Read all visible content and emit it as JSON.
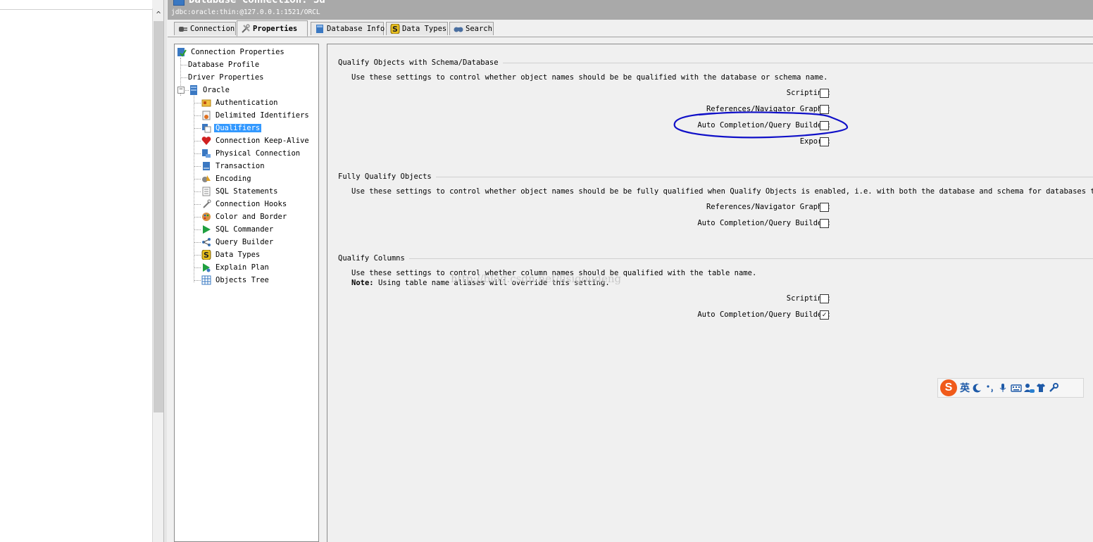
{
  "window": {
    "title": "Database Connection: 3d",
    "jdbc_url": "jdbc:oracle:thin:@127.0.0.1:1521/ORCL"
  },
  "tabs": [
    {
      "label": "Connection",
      "icon": "plug-icon"
    },
    {
      "label": "Properties",
      "icon": "tools-icon",
      "active": true
    },
    {
      "label": "Database Info",
      "icon": "database-icon"
    },
    {
      "label": "Data Types",
      "icon": "dollar-s-icon"
    },
    {
      "label": "Search",
      "icon": "binoculars-icon"
    }
  ],
  "tree": {
    "root": "Connection Properties",
    "top_items": [
      "Database Profile",
      "Driver Properties"
    ],
    "oracle": "Oracle",
    "oracle_items": [
      "Authentication",
      "Delimited Identifiers",
      "Qualifiers",
      "Connection Keep-Alive",
      "Physical Connection",
      "Transaction",
      "Encoding",
      "SQL Statements",
      "Connection Hooks",
      "Color and Border",
      "SQL Commander",
      "Query Builder",
      "Data Types",
      "Explain Plan",
      "Objects Tree"
    ],
    "selected": "Qualifiers"
  },
  "sections": {
    "qualify_objects": {
      "title": "Qualify Objects with Schema/Database",
      "description": "Use these settings to control whether object names should be be qualified with the database or schema name.",
      "options": [
        {
          "label": "Scripting:",
          "checked": false
        },
        {
          "label": "References/Navigator Graphs:",
          "checked": false
        },
        {
          "label": "Auto Completion/Query Builder:",
          "checked": false
        },
        {
          "label": "Export:",
          "checked": false
        }
      ]
    },
    "fully_qualify": {
      "title": "Fully Qualify Objects",
      "description": "Use these settings to control whether object names should be be fully qualified when Qualify Objects is enabled, i.e. with both the database and schema for databases that have",
      "options": [
        {
          "label": "References/Navigator Graphs:",
          "checked": false
        },
        {
          "label": "Auto Completion/Query Builder:",
          "checked": false
        }
      ]
    },
    "qualify_columns": {
      "title": "Qualify Columns",
      "description": "Use these settings to control whether column names should be qualified with the table name.",
      "note_label": "Note:",
      "note_text": "Using table name aliases will override this setting.",
      "options": [
        {
          "label": "Scripting:",
          "checked": false
        },
        {
          "label": "Auto Completion/Query Builder:",
          "checked": true
        }
      ]
    }
  },
  "check_mark": "✓",
  "watermark": "http://blog.csdn.net/lisigoudeng",
  "ime_bar": {
    "logo": "S",
    "mode": "英",
    "icons": [
      "moon-icon",
      "punctuation-icon",
      "microphone-icon",
      "keyboard-icon",
      "user-icon",
      "shirt-icon",
      "wrench-icon"
    ]
  },
  "colors": {
    "header_bg": "#a9a9a9",
    "selection": "#3399ff",
    "annotation": "#1010c8",
    "ime_logo": "#f05a1a"
  }
}
